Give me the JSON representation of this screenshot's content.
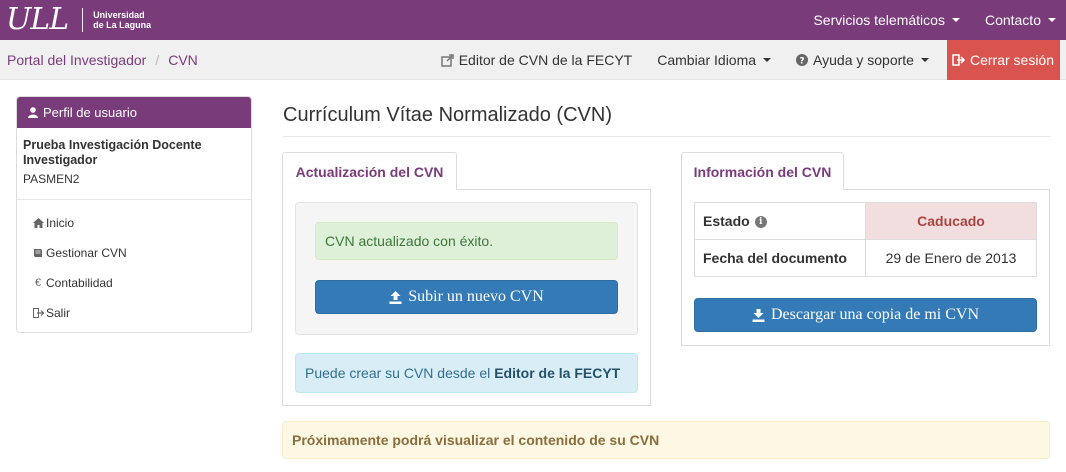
{
  "brand": {
    "logo_text": "ULL",
    "university_line1": "Universidad",
    "university_line2": "de La Laguna"
  },
  "top_nav": {
    "services": "Servicios telemáticos",
    "contact": "Contacto"
  },
  "breadcrumb": {
    "portal": "Portal del Investigador",
    "current": "CVN",
    "separator": "/"
  },
  "sub_nav": {
    "editor": "Editor de CVN de la FECYT",
    "language": "Cambiar Idioma",
    "help": "Ayuda y soporte",
    "logout": "Cerrar sesión"
  },
  "sidebar": {
    "header": "Perfil de usuario",
    "user_name_line1": "Prueba Investigación Docente",
    "user_name_line2": "Investigador",
    "user_code": "PASMEN2",
    "items": [
      {
        "label": "Inicio",
        "icon": "home-icon"
      },
      {
        "label": "Gestionar CVN",
        "icon": "book-icon"
      },
      {
        "label": "Contabilidad",
        "icon": "euro-icon"
      },
      {
        "label": "Salir",
        "icon": "logout-icon"
      }
    ],
    "euro_symbol": "€"
  },
  "main": {
    "title": "Currículum Vítae Normalizado (CVN)",
    "update_tab": "Actualización del CVN",
    "success_msg": "CVN actualizado con éxito.",
    "upload_button": "Subir un nuevo CVN",
    "info_msg_prefix": "Puede crear su CVN desde el",
    "info_msg_link": "Editor de la FECYT",
    "info_tab": "Información del CVN",
    "status_label": "Estado",
    "status_value": "Caducado",
    "date_label": "Fecha del documento",
    "date_value": "29 de Enero de 2013",
    "download_button": "Descargar una copia de mi CVN",
    "coming_soon": "Próximamente podrá visualizar el contenido de su CVN"
  },
  "colors": {
    "brand_purple": "#7a3b7b",
    "danger": "#d9534f",
    "primary": "#337ab7"
  }
}
